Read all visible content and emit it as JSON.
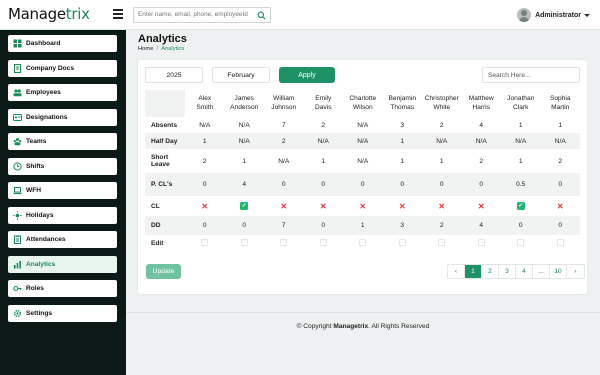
{
  "app": {
    "logo_prefix": "Manage",
    "logo_accent": "trix",
    "accent_color": "#1e8a5c"
  },
  "topbar": {
    "search_placeholder": "Enter name, email, phone, employeeId",
    "user_name": "Administrator"
  },
  "sidebar": {
    "items": [
      {
        "label": "Dashboard",
        "icon": "dashboard-icon"
      },
      {
        "label": "Company Docs",
        "icon": "document-icon"
      },
      {
        "label": "Employees",
        "icon": "people-icon"
      },
      {
        "label": "Designations",
        "icon": "id-card-icon"
      },
      {
        "label": "Teams",
        "icon": "team-icon"
      },
      {
        "label": "Shifts",
        "icon": "shifts-icon"
      },
      {
        "label": "WFH",
        "icon": "laptop-icon"
      },
      {
        "label": "Holidays",
        "icon": "sun-icon"
      },
      {
        "label": "Attendances",
        "icon": "clipboard-icon"
      },
      {
        "label": "Analytics",
        "icon": "chart-icon",
        "active": true
      },
      {
        "label": "Roles",
        "icon": "key-icon"
      },
      {
        "label": "Settings",
        "icon": "gear-icon"
      }
    ]
  },
  "page": {
    "title": "Analytics",
    "breadcrumb_home": "Home",
    "breadcrumb_sep": "/",
    "breadcrumb_current": "Analytics"
  },
  "filters": {
    "year": "2025",
    "month": "February",
    "apply_label": "Apply",
    "search_placeholder": "Search Here..."
  },
  "table": {
    "employees": [
      [
        "Alex",
        "Smith"
      ],
      [
        "James",
        "Anderson"
      ],
      [
        "William",
        "Johnson"
      ],
      [
        "Emily",
        "Davis"
      ],
      [
        "Charlotte",
        "Wilson"
      ],
      [
        "Benjamin",
        "Thomas"
      ],
      [
        "Christopher",
        "White"
      ],
      [
        "Matthew",
        "Harris"
      ],
      [
        "Jonathan",
        "Clark"
      ],
      [
        "Sophia",
        "Martin"
      ]
    ],
    "rows": [
      {
        "label": "Absents",
        "values": [
          "N/A",
          "N/A",
          "7",
          "2",
          "N/A",
          "3",
          "2",
          "4",
          "1",
          "1"
        ]
      },
      {
        "label": "Half Day",
        "values": [
          "1",
          "N/A",
          "2",
          "N/A",
          "N/A",
          "1",
          "N/A",
          "N/A",
          "N/A",
          "N/A"
        ]
      },
      {
        "label": "Short Leave",
        "values": [
          "2",
          "1",
          "N/A",
          "1",
          "N/A",
          "1",
          "1",
          "2",
          "1",
          "2"
        ]
      },
      {
        "label": "P. CL's",
        "values": [
          "0",
          "4",
          "0",
          "0",
          "0",
          "0",
          "0",
          "0",
          "0.5",
          "0"
        ]
      },
      {
        "label": "CL",
        "values": [
          "no",
          "yes",
          "no",
          "no",
          "no",
          "no",
          "no",
          "no",
          "yes",
          "no"
        ]
      },
      {
        "label": "DD",
        "values": [
          "0",
          "0",
          "7",
          "0",
          "1",
          "3",
          "2",
          "4",
          "0",
          "0"
        ]
      },
      {
        "label": "Edit",
        "values": [
          "",
          "",
          "",
          "",
          "",
          "",
          "",
          "",
          "",
          ""
        ]
      }
    ],
    "cross_color": "#e0393e",
    "check_color": "#22b573"
  },
  "actions": {
    "update_label": "Update"
  },
  "pagination": {
    "prev": "‹",
    "pages": [
      "1",
      "2",
      "3",
      "4",
      "...",
      "10"
    ],
    "current": "1",
    "next": "›"
  },
  "footer": {
    "prefix": "© Copyright ",
    "brand": "Managetrix",
    "suffix": ". All Rights Reserved"
  }
}
